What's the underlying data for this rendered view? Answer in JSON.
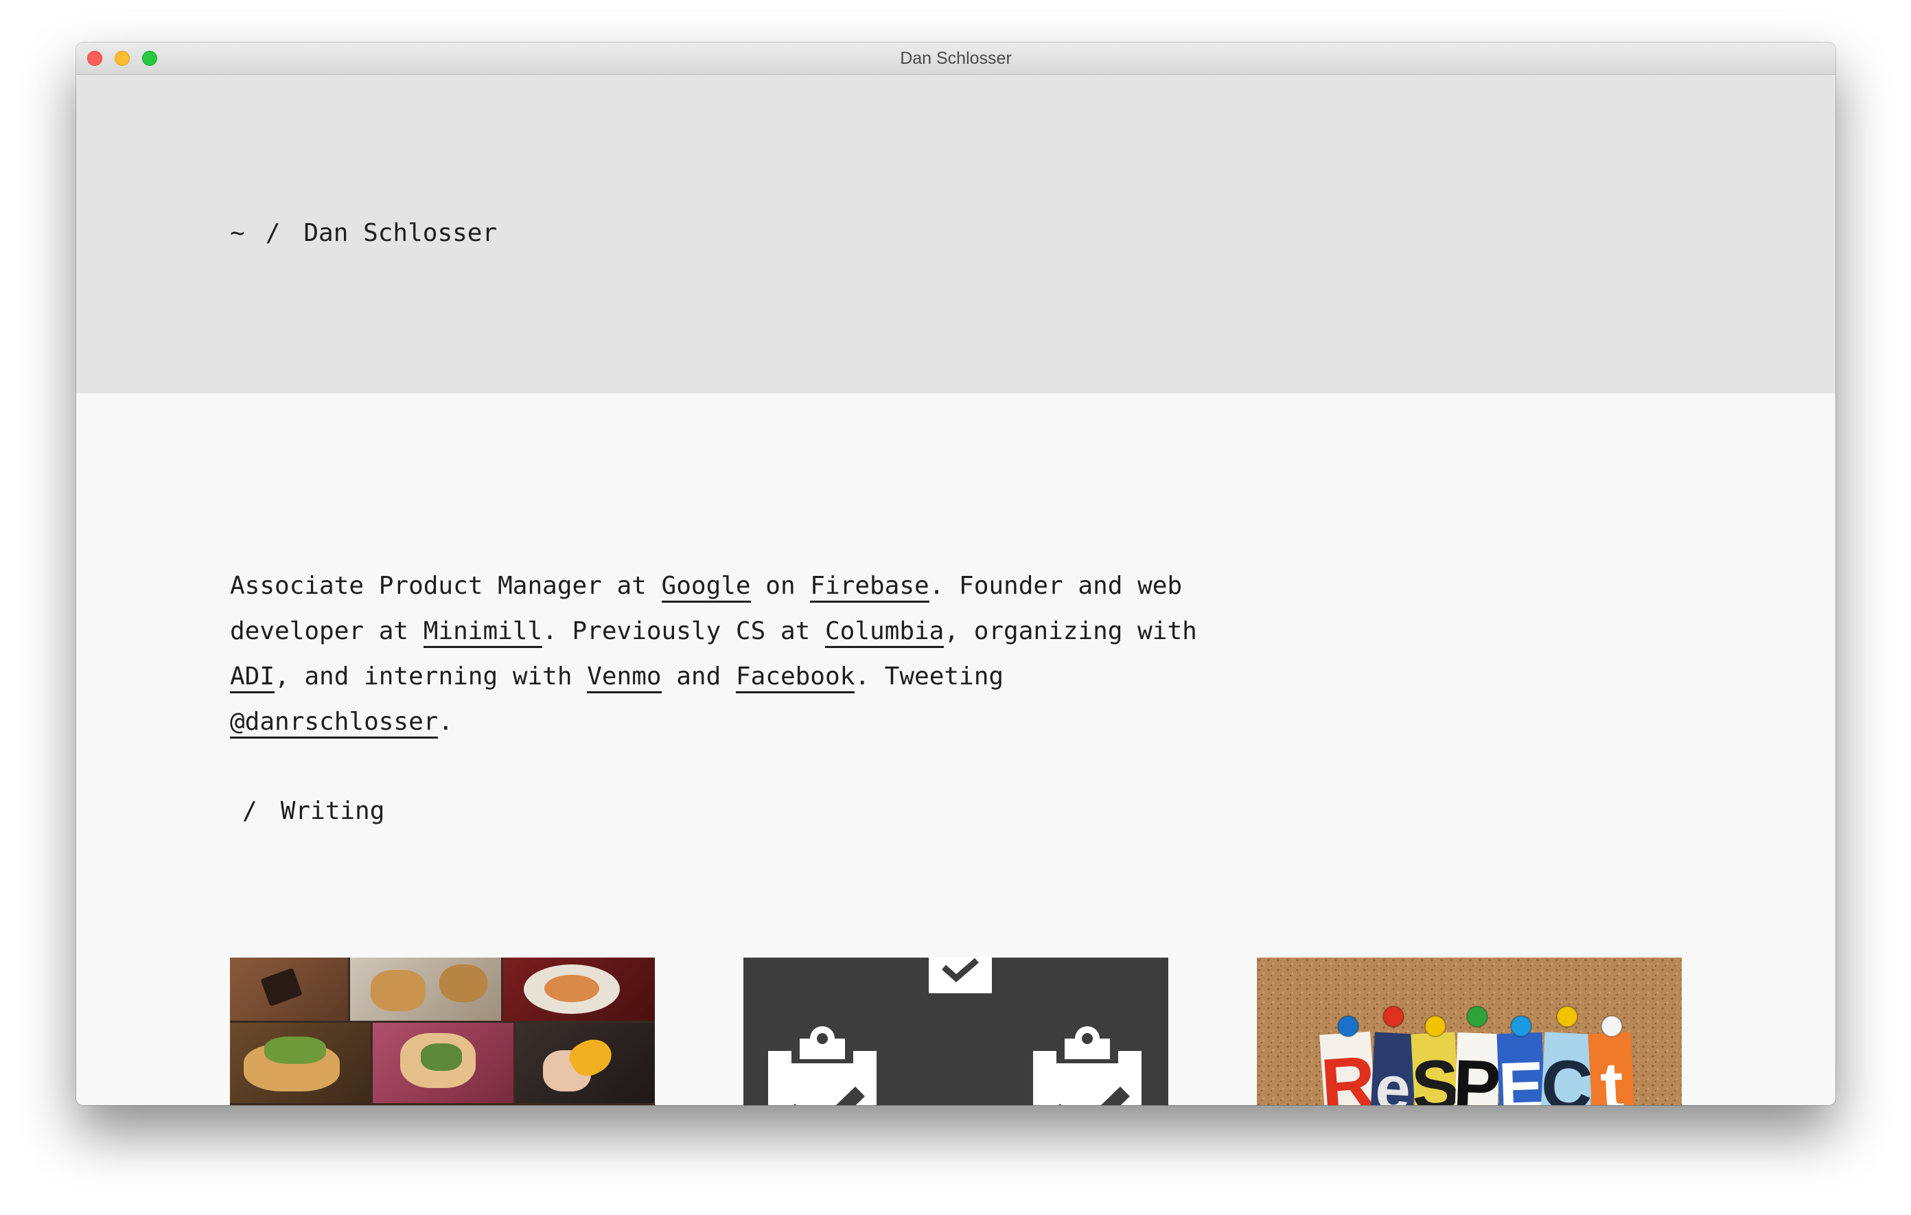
{
  "window": {
    "title": "Dan Schlosser"
  },
  "header": {
    "breadcrumb": {
      "home": "~",
      "separator": "/",
      "current": "Dan Schlosser"
    }
  },
  "bio": {
    "t1": "Associate Product Manager at ",
    "l1": "Google",
    "t2": " on ",
    "l2": "Firebase",
    "t3": ". Founder and web developer at ",
    "l3": "Minimill",
    "t4": ". Previously CS at ",
    "l4": "Columbia",
    "t5": ", organizing with ",
    "l5": "ADI",
    "t6": ", and interning with ",
    "l6": "Venmo",
    "t7": " and ",
    "l7": "Facebook",
    "t8": ". Tweeting ",
    "l8": "@danrschlosser",
    "t9": "."
  },
  "writing": {
    "separator": "/",
    "title": "Writing"
  },
  "cards": [
    {
      "name": "food-collage",
      "icon": "photo-collage"
    },
    {
      "name": "clipboard-checklist",
      "icon": "clipboard-check-icon"
    },
    {
      "name": "respect-corkboard",
      "icon": "respect-letters",
      "letters": [
        "R",
        "e",
        "S",
        "P",
        "E",
        "C",
        "t"
      ]
    }
  ],
  "colors": {
    "hero_bg": "#e4e4e4",
    "page_bg": "#f8f8f8",
    "text": "#1e1e1e"
  }
}
